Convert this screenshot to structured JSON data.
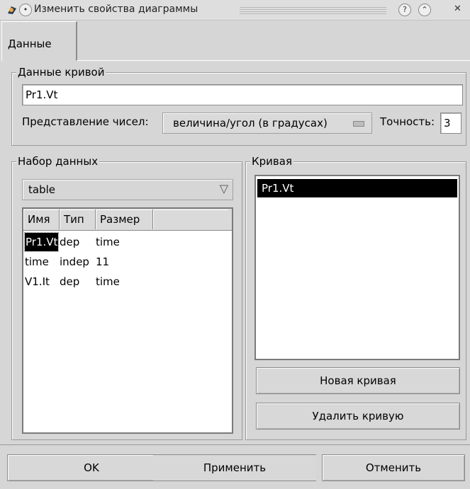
{
  "window": {
    "title": "Изменить свойства диаграммы",
    "help_label": "?",
    "shade_label": "⌃",
    "close_label": "✕"
  },
  "tabs": [
    {
      "label": "Данные"
    }
  ],
  "curve_data": {
    "group_title": "Данные кривой",
    "name_value": "Pr1.Vt",
    "number_repr_label": "Представление чисел:",
    "number_repr_value": "величина/угол (в градусах)",
    "precision_label": "Точность:",
    "precision_value": "3"
  },
  "dataset": {
    "group_title": "Набор данных",
    "selected": "table",
    "dropdown_glyph": "▽",
    "columns": [
      "Имя",
      "Тип",
      "Размер"
    ],
    "rows": [
      [
        "Pr1.Vt",
        "dep",
        "time"
      ],
      [
        "time",
        "indep",
        "11"
      ],
      [
        "V1.It",
        "dep",
        "time"
      ]
    ]
  },
  "curve": {
    "group_title": "Кривая",
    "items": [
      "Pr1.Vt"
    ],
    "new_button": "Новая кривая",
    "delete_button": "Удалить кривую"
  },
  "footer": {
    "ok": "OK",
    "apply": "Применить",
    "cancel": "Отменить"
  }
}
